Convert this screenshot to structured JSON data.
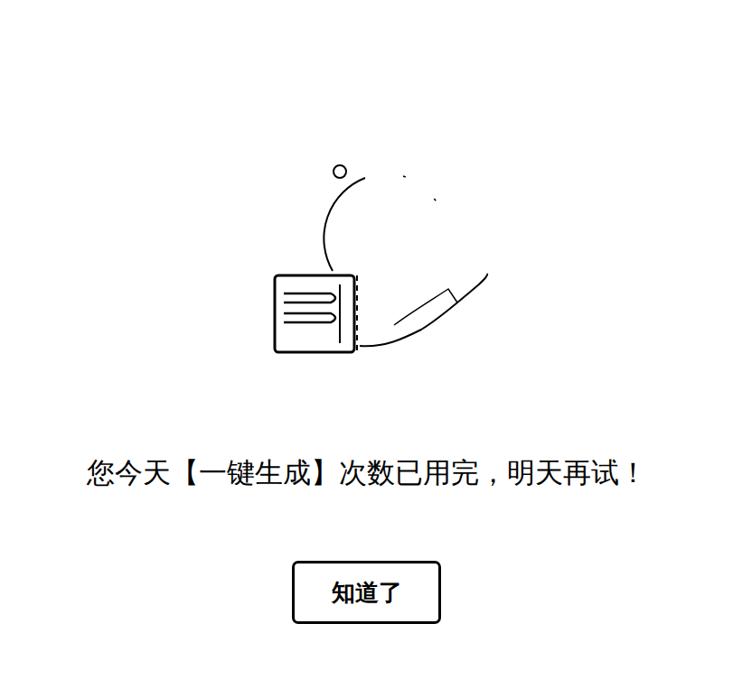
{
  "dialog": {
    "message": "您今天【一键生成】次数已用完，明天再试！",
    "button": {
      "label": "知道了"
    }
  }
}
